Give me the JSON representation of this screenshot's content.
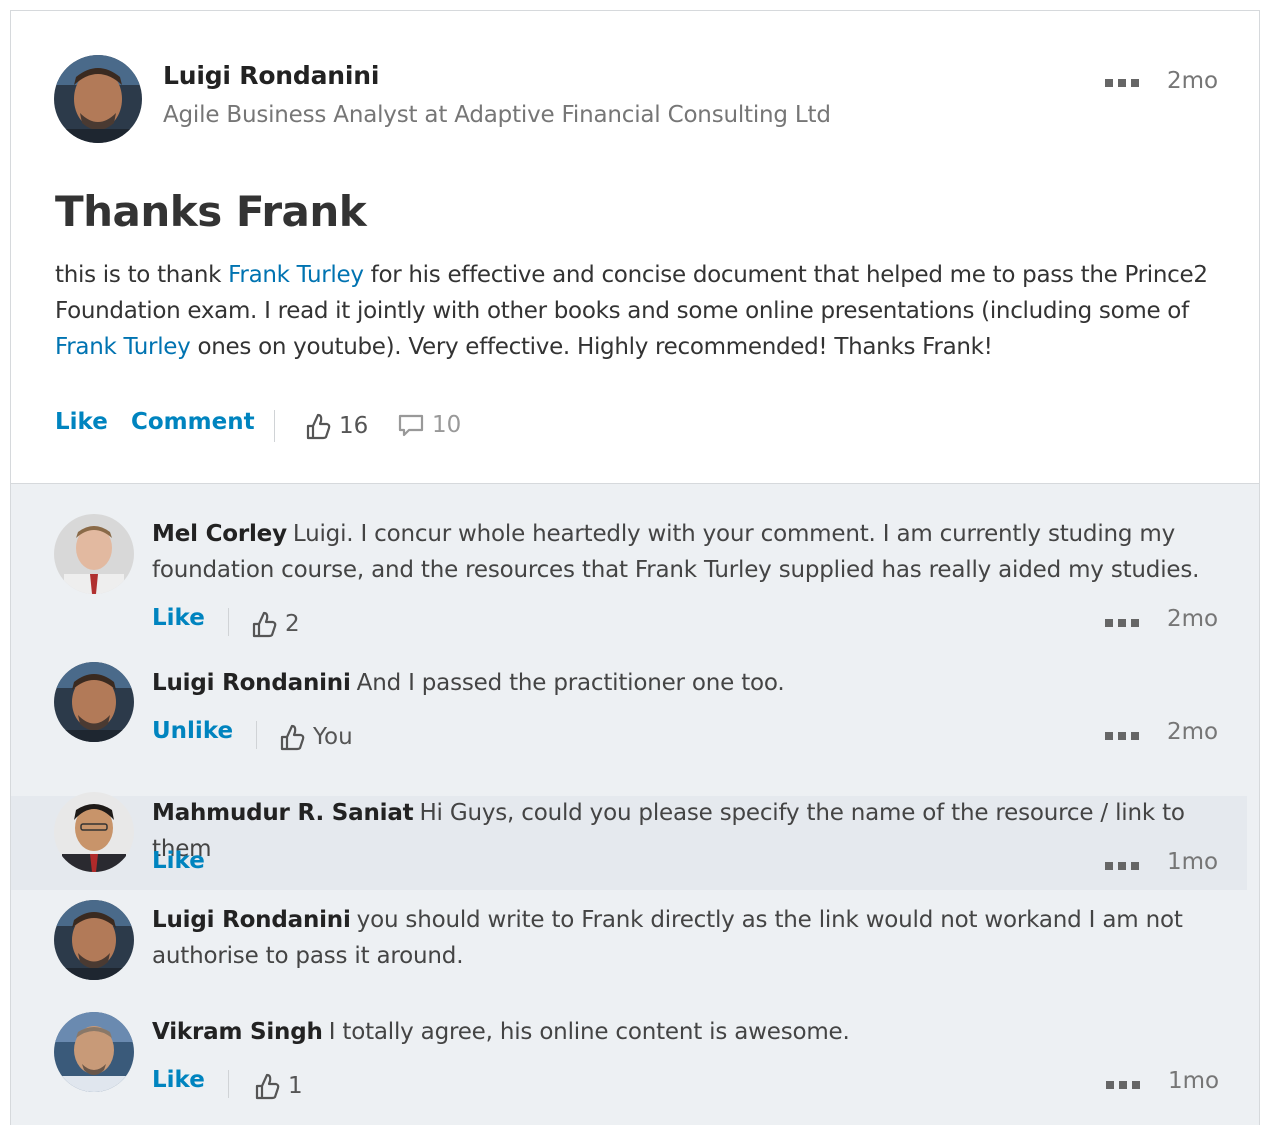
{
  "post": {
    "author_name": "Luigi Rondanini",
    "author_title": "Agile Business Analyst at Adaptive Financial Consulting Ltd",
    "time": "2mo",
    "title": "Thanks Frank",
    "body": {
      "part1": "this is to thank ",
      "mention1": "Frank Turley",
      "part2": " for his effective and concise document that helped me to pass the Prince2 Foundation exam. I read it jointly with other books and some online presentations (including some of ",
      "mention2": "Frank Turley",
      "part3": " ones on youtube). Very effective. Highly recommended! Thanks Frank!"
    },
    "actions": {
      "like": "Like",
      "comment": "Comment"
    },
    "like_count": "16",
    "comment_count": "10"
  },
  "comments": [
    {
      "author": "Mel Corley",
      "text": "Luigi. I concur whole heartedly with your comment. I am currently studing my foundation course, and the resources that Frank Turley supplied has really aided my studies.",
      "action": "Like",
      "likes": "2",
      "time": "2mo"
    },
    {
      "author": "Luigi Rondanini",
      "text": "And I passed the practitioner one too.",
      "action": "Unlike",
      "likes": "You",
      "time": "2mo"
    },
    {
      "author": "Mahmudur R. Saniat",
      "text": "Hi Guys, could you please specify the name of the resource / link to them",
      "action": "Like",
      "time": "1mo"
    },
    {
      "author": "Luigi Rondanini",
      "text": "you should write to Frank directly as the link would not workand I am not authorise to pass it around."
    },
    {
      "author": "Vikram Singh",
      "text": "I totally agree, his online content is awesome.",
      "action": "Like",
      "likes": "1",
      "time": "1mo"
    }
  ],
  "icons": {
    "more": "more-dots-icon",
    "like": "thumbs-up-icon",
    "comment": "comment-bubble-icon"
  },
  "colors": {
    "link": "#0084bf",
    "mention": "#0073b1",
    "comments_bg": "#edf0f3"
  }
}
